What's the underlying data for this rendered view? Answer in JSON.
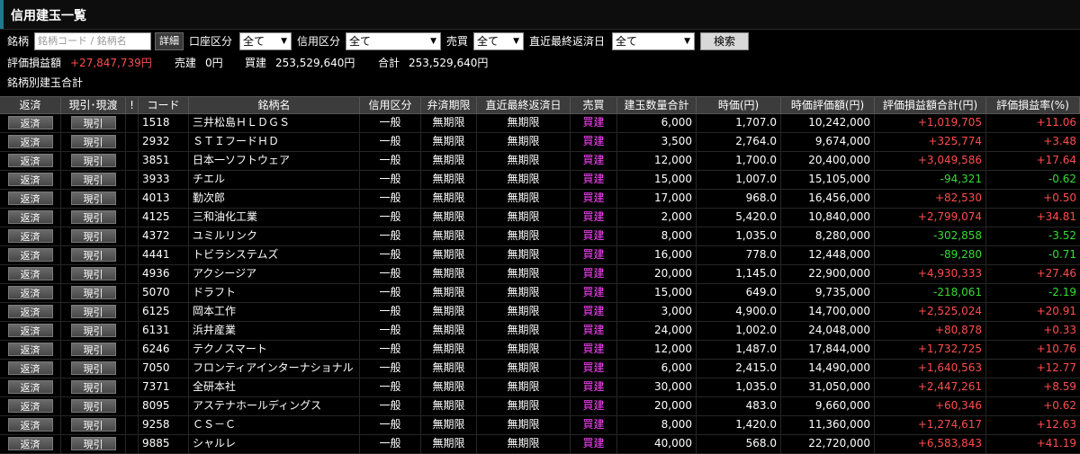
{
  "title": "信用建玉一覧",
  "filters": {
    "meigara_label": "銘柄",
    "meigara_placeholder": "銘柄コード / 銘柄名",
    "detail_button": "詳細",
    "koza_label": "口座区分",
    "koza_value": "全て",
    "shinyo_label": "信用区分",
    "shinyo_value": "全て",
    "baibai_label": "売買",
    "baibai_value": "全て",
    "hensai_label": "直近最終返済日",
    "hensai_value": "全て",
    "search_button": "検索"
  },
  "summary": {
    "pl_label": "評価損益額",
    "pl_value": "+27,847,739円",
    "uridate_label": "売建",
    "uridate_value": "0円",
    "kaidate_label": "買建",
    "kaidate_value": "253,529,640円",
    "total_label": "合計",
    "total_value": "253,529,640円"
  },
  "section_title": "銘柄別建玉合計",
  "columns": {
    "hensai": "返済",
    "genbiki": "現引･現渡",
    "warn": "!",
    "code": "コード",
    "name": "銘柄名",
    "kubun": "信用区分",
    "kigen": "弁済期限",
    "hensaibi": "直近最終返済日",
    "baibai": "売買",
    "qty": "建玉数量合計",
    "price": "時価(円)",
    "val": "時価評価額(円)",
    "pl": "評価損益額合計(円)",
    "rate": "評価損益率(%)"
  },
  "row_buttons": {
    "hensai": "返済",
    "genbiki": "現引"
  },
  "colors": {
    "positive": "#ff4d4d",
    "negative": "#33dd33",
    "buy": "#ff44ff",
    "accent": "#1e7a8c"
  },
  "rows": [
    {
      "code": "1518",
      "name": "三井松島ＨＬＤＧＳ",
      "kubun": "一般",
      "kigen": "無期限",
      "hensaibi": "無期限",
      "baibai": "買建",
      "qty": "6,000",
      "price": "1,707.0",
      "val": "10,242,000",
      "pl": "+1,019,705",
      "rate": "+11.06"
    },
    {
      "code": "2932",
      "name": "ＳＴＩフードＨＤ",
      "kubun": "一般",
      "kigen": "無期限",
      "hensaibi": "無期限",
      "baibai": "買建",
      "qty": "3,500",
      "price": "2,764.0",
      "val": "9,674,000",
      "pl": "+325,774",
      "rate": "+3.48"
    },
    {
      "code": "3851",
      "name": "日本一ソフトウェア",
      "kubun": "一般",
      "kigen": "無期限",
      "hensaibi": "無期限",
      "baibai": "買建",
      "qty": "12,000",
      "price": "1,700.0",
      "val": "20,400,000",
      "pl": "+3,049,586",
      "rate": "+17.64"
    },
    {
      "code": "3933",
      "name": "チエル",
      "kubun": "一般",
      "kigen": "無期限",
      "hensaibi": "無期限",
      "baibai": "買建",
      "qty": "15,000",
      "price": "1,007.0",
      "val": "15,105,000",
      "pl": "-94,321",
      "rate": "-0.62"
    },
    {
      "code": "4013",
      "name": "勤次郎",
      "kubun": "一般",
      "kigen": "無期限",
      "hensaibi": "無期限",
      "baibai": "買建",
      "qty": "17,000",
      "price": "968.0",
      "val": "16,456,000",
      "pl": "+82,530",
      "rate": "+0.50"
    },
    {
      "code": "4125",
      "name": "三和油化工業",
      "kubun": "一般",
      "kigen": "無期限",
      "hensaibi": "無期限",
      "baibai": "買建",
      "qty": "2,000",
      "price": "5,420.0",
      "val": "10,840,000",
      "pl": "+2,799,074",
      "rate": "+34.81"
    },
    {
      "code": "4372",
      "name": "ユミルリンク",
      "kubun": "一般",
      "kigen": "無期限",
      "hensaibi": "無期限",
      "baibai": "買建",
      "qty": "8,000",
      "price": "1,035.0",
      "val": "8,280,000",
      "pl": "-302,858",
      "rate": "-3.52"
    },
    {
      "code": "4441",
      "name": "トビラシステムズ",
      "kubun": "一般",
      "kigen": "無期限",
      "hensaibi": "無期限",
      "baibai": "買建",
      "qty": "16,000",
      "price": "778.0",
      "val": "12,448,000",
      "pl": "-89,280",
      "rate": "-0.71"
    },
    {
      "code": "4936",
      "name": "アクシージア",
      "kubun": "一般",
      "kigen": "無期限",
      "hensaibi": "無期限",
      "baibai": "買建",
      "qty": "20,000",
      "price": "1,145.0",
      "val": "22,900,000",
      "pl": "+4,930,333",
      "rate": "+27.46"
    },
    {
      "code": "5070",
      "name": "ドラフト",
      "kubun": "一般",
      "kigen": "無期限",
      "hensaibi": "無期限",
      "baibai": "買建",
      "qty": "15,000",
      "price": "649.0",
      "val": "9,735,000",
      "pl": "-218,061",
      "rate": "-2.19"
    },
    {
      "code": "6125",
      "name": "岡本工作",
      "kubun": "一般",
      "kigen": "無期限",
      "hensaibi": "無期限",
      "baibai": "買建",
      "qty": "3,000",
      "price": "4,900.0",
      "val": "14,700,000",
      "pl": "+2,525,024",
      "rate": "+20.91"
    },
    {
      "code": "6131",
      "name": "浜井産業",
      "kubun": "一般",
      "kigen": "無期限",
      "hensaibi": "無期限",
      "baibai": "買建",
      "qty": "24,000",
      "price": "1,002.0",
      "val": "24,048,000",
      "pl": "+80,878",
      "rate": "+0.33"
    },
    {
      "code": "6246",
      "name": "テクノスマート",
      "kubun": "一般",
      "kigen": "無期限",
      "hensaibi": "無期限",
      "baibai": "買建",
      "qty": "12,000",
      "price": "1,487.0",
      "val": "17,844,000",
      "pl": "+1,732,725",
      "rate": "+10.76"
    },
    {
      "code": "7050",
      "name": "フロンティアインターナショナル",
      "kubun": "一般",
      "kigen": "無期限",
      "hensaibi": "無期限",
      "baibai": "買建",
      "qty": "6,000",
      "price": "2,415.0",
      "val": "14,490,000",
      "pl": "+1,640,563",
      "rate": "+12.77"
    },
    {
      "code": "7371",
      "name": "全研本社",
      "kubun": "一般",
      "kigen": "無期限",
      "hensaibi": "無期限",
      "baibai": "買建",
      "qty": "30,000",
      "price": "1,035.0",
      "val": "31,050,000",
      "pl": "+2,447,261",
      "rate": "+8.59"
    },
    {
      "code": "8095",
      "name": "アステナホールディングス",
      "kubun": "一般",
      "kigen": "無期限",
      "hensaibi": "無期限",
      "baibai": "買建",
      "qty": "20,000",
      "price": "483.0",
      "val": "9,660,000",
      "pl": "+60,346",
      "rate": "+0.62"
    },
    {
      "code": "9258",
      "name": "ＣＳ－Ｃ",
      "kubun": "一般",
      "kigen": "無期限",
      "hensaibi": "無期限",
      "baibai": "買建",
      "qty": "8,000",
      "price": "1,420.0",
      "val": "11,360,000",
      "pl": "+1,274,617",
      "rate": "+12.63"
    },
    {
      "code": "9885",
      "name": "シャルレ",
      "kubun": "一般",
      "kigen": "無期限",
      "hensaibi": "無期限",
      "baibai": "買建",
      "qty": "40,000",
      "price": "568.0",
      "val": "22,720,000",
      "pl": "+6,583,843",
      "rate": "+41.19"
    }
  ]
}
